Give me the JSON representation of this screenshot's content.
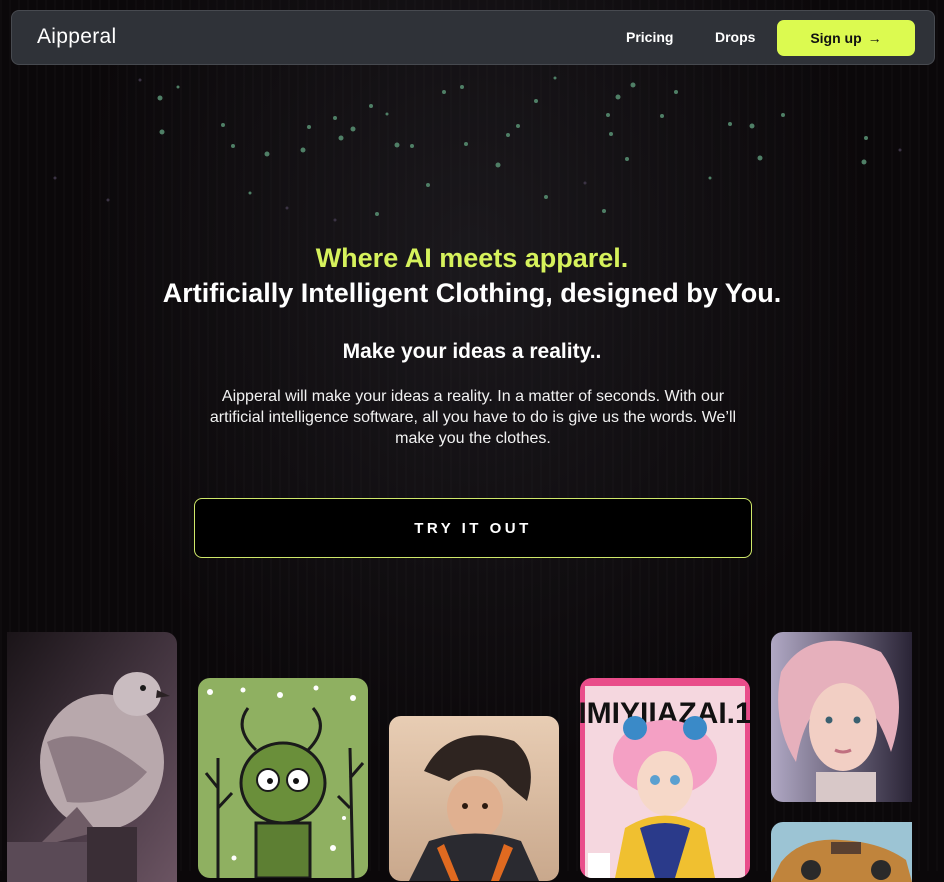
{
  "nav": {
    "logo": "Aipperal",
    "links": [
      "Pricing",
      "Drops"
    ],
    "signup_label": "Sign up",
    "signup_arrow": "→"
  },
  "hero": {
    "tagline": "Where AI meets apparel.",
    "title": "Artificially Intelligent Clothing, designed by You.",
    "subtitle": "Make your ideas a reality..",
    "description": "Aipperal will make your ideas a reality. In a matter of seconds. With our artificial intelligence software, all you have to do is give us the words. We’ll make you the clothes.",
    "cta_label": "TRY IT OUT"
  },
  "gallery": {
    "items": [
      "dove-image",
      "green-creature-image",
      "anime-boy-image",
      "manga-cover-image",
      "pink-hair-portrait-image",
      "car-image"
    ],
    "magazine_title": "IMIYIIAZAI.1"
  },
  "colors": {
    "accent": "#dcfa50",
    "navbar": "#2f3238",
    "background": "#0b080a"
  }
}
